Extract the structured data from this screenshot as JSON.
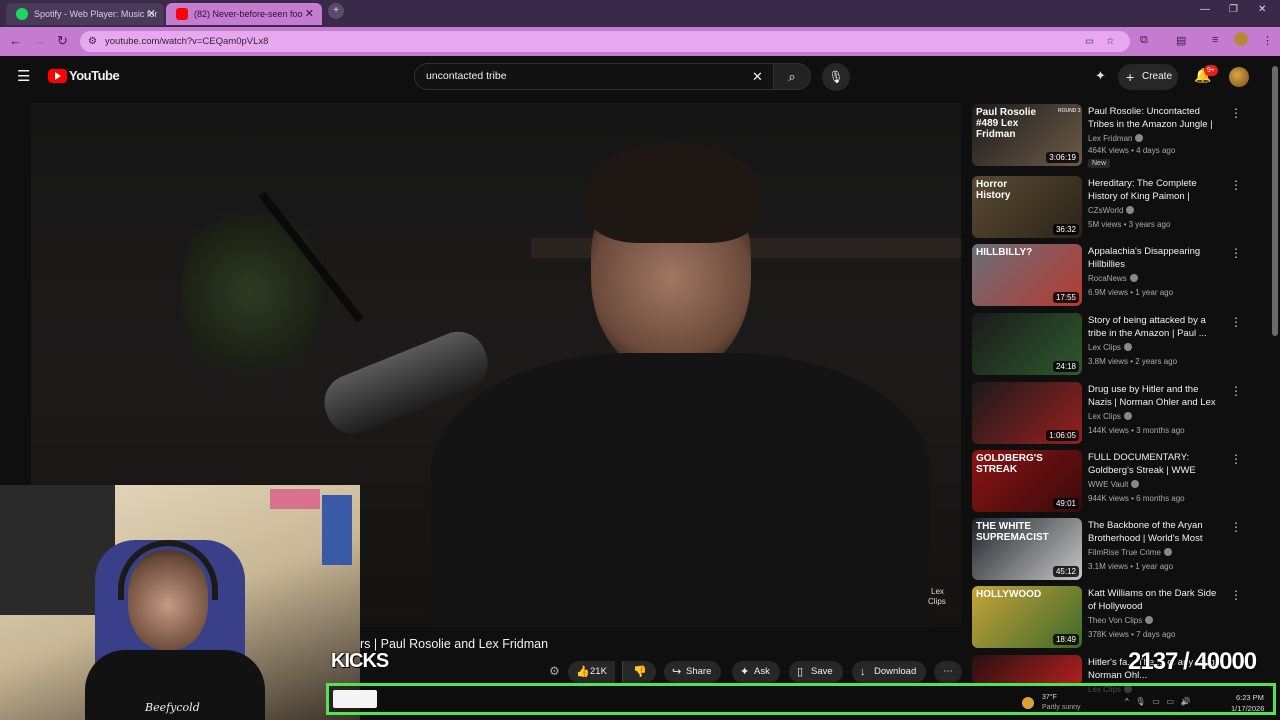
{
  "browser": {
    "tabs": [
      {
        "label": "Spotify - Web Player: Music for",
        "active": false
      },
      {
        "label": "(82) Never-before-seen foo",
        "active": true
      }
    ],
    "url": "youtube.com/watch?v=CEQam0pVLx8"
  },
  "youtube": {
    "logo_text": "YouTube",
    "search_value": "uncontacted tribe",
    "create_label": "Create",
    "notif_count": "9+"
  },
  "video": {
    "watermark_line1": "Lex",
    "watermark_line2": "Clips",
    "title_visible": "rs | Paul Rosolie and Lex Fridman"
  },
  "actions": {
    "likes": "21K",
    "share": "Share",
    "ask": "Ask",
    "save": "Save",
    "download": "Download"
  },
  "recommendations": [
    {
      "title": "Paul Rosolie: Uncontacted Tribes in the Amazon Jungle | ...",
      "channel": "Lex Fridman",
      "meta": "464K views • 4 days ago",
      "duration": "3:06:19",
      "badge": "New",
      "thumb_text": "Paul Rosolie #489 Lex Fridman",
      "thumb_badge": "ROUND 3",
      "colors": [
        "#1c1c1c",
        "#6c5a48"
      ]
    },
    {
      "title": "Hereditary: The Complete History of King Paimon | Horro...",
      "channel": "CZsWorld",
      "meta": "5M views • 3 years ago",
      "duration": "36:32",
      "badge": "",
      "thumb_text": "Horror History",
      "thumb_badge": "",
      "colors": [
        "#5b4a33",
        "#2b2418"
      ]
    },
    {
      "title": "Appalachia's Disappearing Hillbillies",
      "channel": "RocaNews",
      "meta": "6.9M views • 1 year ago",
      "duration": "17:55",
      "badge": "",
      "thumb_text": "HILLBILLY?",
      "thumb_badge": "",
      "colors": [
        "#6a6e7a",
        "#b63a2f"
      ]
    },
    {
      "title": "Story of being attacked by a tribe in the Amazon | Paul ...",
      "channel": "Lex Clips",
      "meta": "3.8M views • 2 years ago",
      "duration": "24:18",
      "badge": "",
      "thumb_text": "",
      "thumb_badge": "",
      "colors": [
        "#1a1a1a",
        "#2e5a2e"
      ]
    },
    {
      "title": "Drug use by Hitler and the Nazis | Norman Ohler and Lex ...",
      "channel": "Lex Clips",
      "meta": "144K views • 3 months ago",
      "duration": "1:06:05",
      "badge": "",
      "thumb_text": "",
      "thumb_badge": "",
      "colors": [
        "#1a1a1a",
        "#9a1f1f"
      ]
    },
    {
      "title": "FULL DOCUMENTARY: Goldberg's Streak | WWE Untold",
      "channel": "WWE Vault",
      "meta": "944K views • 6 months ago",
      "duration": "49:01",
      "badge": "",
      "thumb_text": "GOLDBERG'S STREAK",
      "thumb_badge": "",
      "colors": [
        "#8a1414",
        "#3a0a0a"
      ]
    },
    {
      "title": "The Backbone of the Aryan Brotherhood | World's Most Evi...",
      "channel": "FilmRise True Crime",
      "meta": "3.1M views • 1 year ago",
      "duration": "45:12",
      "badge": "",
      "thumb_text": "THE WHITE SUPREMACIST",
      "thumb_badge": "",
      "colors": [
        "#20242a",
        "#c8c8c8"
      ]
    },
    {
      "title": "Katt Williams on the Dark Side of Hollywood",
      "channel": "Theo Von Clips",
      "meta": "378K views • 7 days ago",
      "duration": "18:49",
      "badge": "",
      "thumb_text": "HOLLYWOOD",
      "thumb_badge": "",
      "colors": [
        "#c9a23a",
        "#3a6a2a"
      ]
    },
    {
      "title": "Hitler's fa... The ... of any drug | Norman Ohl...",
      "channel": "Lex Clips",
      "meta": "",
      "duration": "",
      "badge": "",
      "thumb_text": "",
      "thumb_badge": "",
      "colors": [
        "#2a1010",
        "#b02020"
      ]
    }
  ],
  "stream_overlay": {
    "kicks_label": "KICKS",
    "counter": "2137 / 40000",
    "shirt_text": "Beefycold"
  },
  "taskbar": {
    "temp": "37°F",
    "weather": "Partly sunny",
    "time": "6:23 PM",
    "date": "1/17/2026"
  }
}
